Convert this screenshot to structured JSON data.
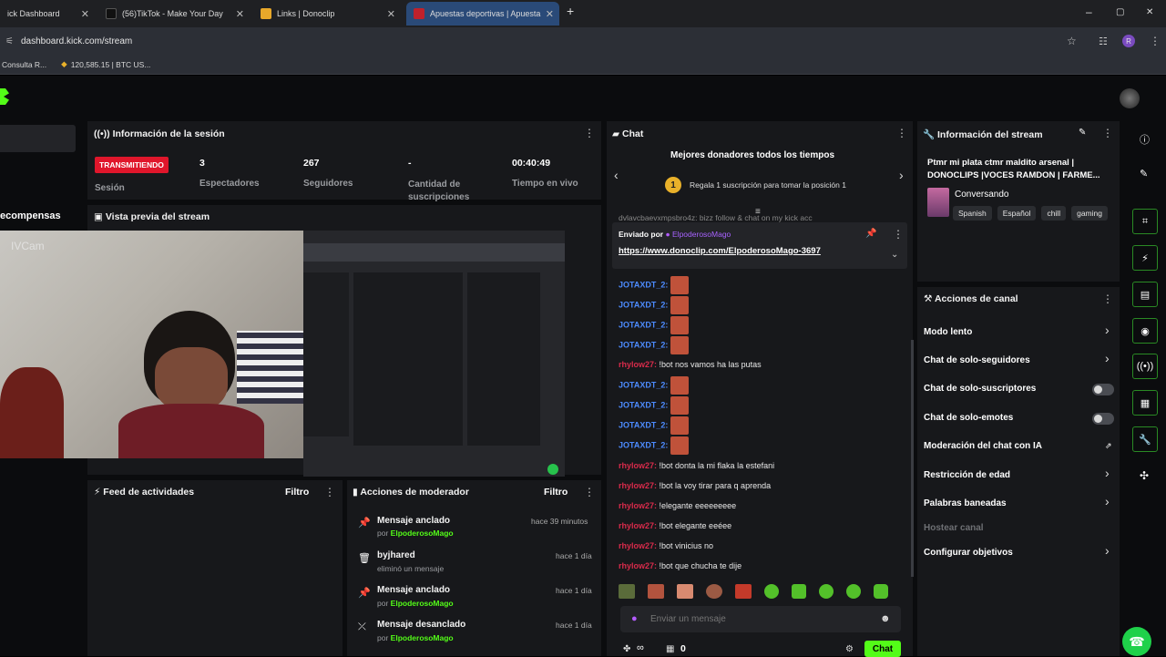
{
  "browser": {
    "tabs": [
      {
        "label": "ick Dashboard",
        "active": false
      },
      {
        "label": "(56)TikTok - Make Your Day",
        "active": false
      },
      {
        "label": "Links | Donoclip",
        "active": false
      },
      {
        "label": "Apuestas deportivas | Apuesta",
        "active": true
      }
    ],
    "new_tab": "+",
    "window": {
      "minimize": "–",
      "maximize": "▢",
      "close": "✕"
    },
    "url": "dashboard.kick.com/stream",
    "profile_initial": "R",
    "bookmarks": [
      "Consulta R...",
      "120,585.15 | BTC US..."
    ]
  },
  "sidebar": {
    "rewards_label": "ecompensas"
  },
  "session": {
    "title": "Información de la sesión",
    "status_badge": "TRANSMITIENDO",
    "status_label": "Sesión",
    "viewers": "3",
    "viewers_label": "Espectadores",
    "followers": "267",
    "followers_label": "Seguidores",
    "subs": "-",
    "subs_label": "Cantidad de suscripciones",
    "uptime": "00:40:49",
    "uptime_label": "Tiempo en vivo"
  },
  "preview": {
    "title": "Vista previa del stream",
    "cam_watermark": "IVCam"
  },
  "feed": {
    "title": "Feed de actividades",
    "filter": "Filtro"
  },
  "mod_actions": {
    "title": "Acciones de moderador",
    "filter": "Filtro",
    "items": [
      {
        "title": "Mensaje anclado",
        "sub_prefix": "por",
        "sub_user": "ElpoderosoMago",
        "time": "hace 39 minutos"
      },
      {
        "title": "byjhared",
        "sub_text": "eliminó un mensaje",
        "time": "hace 1 día"
      },
      {
        "title": "Mensaje anclado",
        "sub_prefix": "por",
        "sub_user": "ElpoderosoMago",
        "time": "hace 1 día"
      },
      {
        "title": "Mensaje desanclado",
        "sub_prefix": "por",
        "sub_user": "ElpoderosoMago",
        "time": "hace 1 día"
      }
    ]
  },
  "chat": {
    "title": "Chat",
    "top_donors_title": "Mejores donadores todos los tiempos",
    "top_donors_rank": "1",
    "top_donors_cta": "Regala 1 suscripción para tomar la posición 1",
    "cut_message": "dvlavcbaevxmpsbro4z: bizz follow & chat on my kick acc",
    "pinned_sent_by": "Enviado por",
    "pinned_user": "ElpoderosoMago",
    "pinned_link": "https://www.donoclip.com/ElpoderosoMago-3697",
    "messages": [
      {
        "user": "JOTAXDT_2:",
        "color": "blue",
        "text": "",
        "emote": true
      },
      {
        "user": "JOTAXDT_2:",
        "color": "blue",
        "text": "",
        "emote": true
      },
      {
        "user": "JOTAXDT_2:",
        "color": "blue",
        "text": "",
        "emote": true
      },
      {
        "user": "JOTAXDT_2:",
        "color": "blue",
        "text": "",
        "emote": true
      },
      {
        "user": "rhylow27:",
        "color": "red",
        "text": " !bot nos vamos ha las putas",
        "emote": false
      },
      {
        "user": "JOTAXDT_2:",
        "color": "blue",
        "text": "",
        "emote": true
      },
      {
        "user": "JOTAXDT_2:",
        "color": "blue",
        "text": "",
        "emote": true
      },
      {
        "user": "JOTAXDT_2:",
        "color": "blue",
        "text": "",
        "emote": true
      },
      {
        "user": "JOTAXDT_2:",
        "color": "blue",
        "text": "",
        "emote": true
      },
      {
        "user": "rhylow27:",
        "color": "red",
        "text": " !bot donta la mi flaka la estefani",
        "emote": false
      },
      {
        "user": "rhylow27:",
        "color": "red",
        "text": " !bot la voy tirar para q aprenda",
        "emote": false
      },
      {
        "user": "rhylow27:",
        "color": "red",
        "text": " !elegante eeeeeeeee",
        "emote": false
      },
      {
        "user": "rhylow27:",
        "color": "red",
        "text": " !bot elegante eeéee",
        "emote": false
      },
      {
        "user": "rhylow27:",
        "color": "red",
        "text": " !bot vinicius no",
        "emote": false
      },
      {
        "user": "rhylow27:",
        "color": "red",
        "text": " !bot que chucha te dije",
        "emote": false
      }
    ],
    "input_placeholder": "Enviar un mensaje",
    "infinity": "∞",
    "count": "0",
    "send_label": "Chat"
  },
  "stream_info": {
    "title": "Información del stream",
    "stream_title": "Ptmr mi plata ctmr maldito arsenal | DONOCLIPS |VOCES RAMDON | FARME...",
    "category": "Conversando",
    "tags": [
      "Spanish",
      "Español",
      "chill",
      "gaming"
    ]
  },
  "channel_actions": {
    "title": "Acciones de canal",
    "items": [
      {
        "label": "Modo lento",
        "control": "chevron"
      },
      {
        "label": "Chat de solo-seguidores",
        "control": "chevron"
      },
      {
        "label": "Chat de solo-suscriptores",
        "control": "toggle"
      },
      {
        "label": "Chat de solo-emotes",
        "control": "toggle"
      },
      {
        "label": "Moderación del chat con IA",
        "control": "external"
      },
      {
        "label": "Restricción de edad",
        "control": "chevron"
      },
      {
        "label": "Palabras baneadas",
        "control": "chevron"
      },
      {
        "label": "Hostear canal",
        "control": "none"
      },
      {
        "label": "Configurar objetivos",
        "control": "chevron"
      }
    ]
  },
  "colors": {
    "brand": "#53fc18",
    "live_badge": "#e0162b",
    "panel": "#17181b"
  }
}
